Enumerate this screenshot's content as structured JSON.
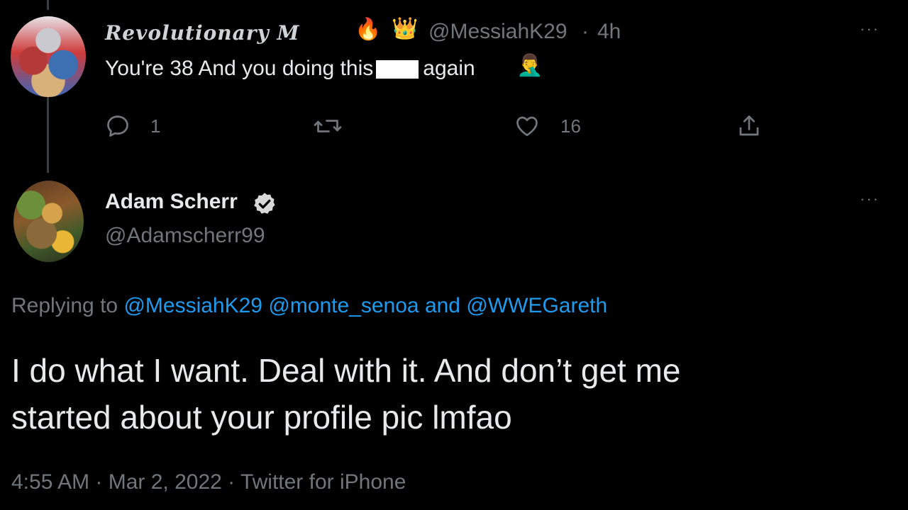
{
  "tweet1": {
    "display_name": "Revolutionary M",
    "emojis": [
      "🔥",
      "👑"
    ],
    "handle": "@MessiahK29",
    "separator": "·",
    "time": "4h",
    "text_before": "You're 38 And you doing this",
    "text_after": "again",
    "trailing_emoji": "🤦‍♂️",
    "actions": {
      "reply_count": "1",
      "like_count": "16"
    },
    "more_label": "···"
  },
  "tweet2": {
    "display_name": "Adam Scherr",
    "verified": true,
    "handle": "@Adamscherr99",
    "more_label": "···",
    "replying_prefix": "Replying to",
    "replying_to": [
      "@MessiahK29",
      "@monte_senoa",
      "@WWEGareth"
    ],
    "replying_and": "and",
    "body_line1": "I do what I want.  Deal with it.  And don’t get me",
    "body_line2": "started about your profile pic lmfao",
    "meta": "4:55 AM · Mar 2, 2022 · Twitter for iPhone"
  },
  "colors": {
    "background": "#000000",
    "text": "#e7e9ea",
    "muted": "#71767b",
    "link": "#1d9bf0"
  }
}
